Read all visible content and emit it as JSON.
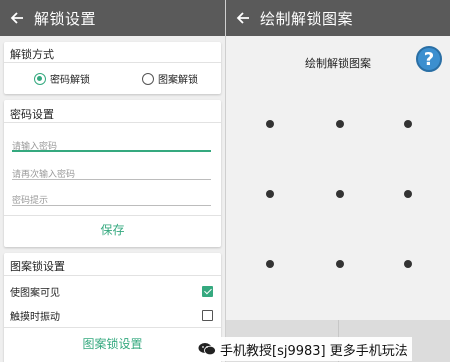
{
  "left_screen": {
    "appbar": {
      "back_icon": "arrow-left-icon",
      "title": "解锁设置"
    },
    "unlock_method": {
      "title": "解锁方式",
      "options": [
        {
          "label": "密码解锁",
          "checked": true
        },
        {
          "label": "图案解锁",
          "checked": false
        }
      ]
    },
    "password_settings": {
      "title": "密码设置",
      "fields": [
        {
          "placeholder": "请输入密码",
          "value": ""
        },
        {
          "placeholder": "请再次输入密码",
          "value": ""
        },
        {
          "placeholder": "密码提示",
          "value": ""
        }
      ],
      "save_label": "保存"
    },
    "pattern_lock_settings": {
      "title": "图案锁设置",
      "options": [
        {
          "label": "使图案可见",
          "checked": true
        },
        {
          "label": "触摸时振动",
          "checked": false
        }
      ],
      "button_label": "图案锁设置"
    }
  },
  "right_screen": {
    "appbar": {
      "back_icon": "arrow-left-icon",
      "title": "绘制解锁图案"
    },
    "pattern_title": "绘制解锁图案",
    "help_icon": "help-icon",
    "help_label": "?",
    "grid": {
      "rows": 3,
      "cols": 3
    },
    "bottom_buttons": [
      "",
      ""
    ]
  },
  "watermark": {
    "icon": "wechat-icon",
    "text": "手机教授[sj9983] 更多手机玩法"
  },
  "colors": {
    "appbar": "#5a5a5a",
    "accent": "#35a97f",
    "help": "#3c8fcf"
  }
}
